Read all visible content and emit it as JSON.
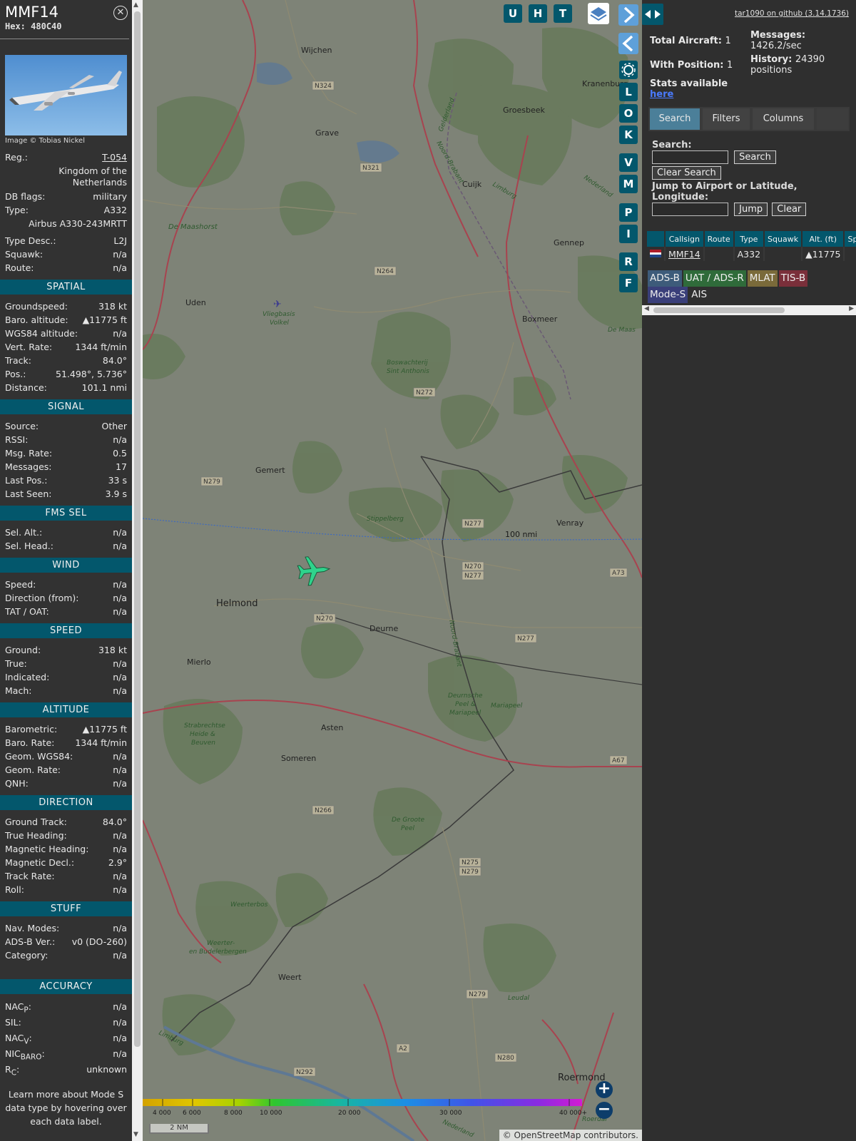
{
  "aircraft": {
    "callsign": "MMF14",
    "hex": "Hex: 480C40",
    "photo_credit": "Image © Tobias Nickel",
    "reg_label": "Reg.:",
    "reg": "T-054",
    "country": "Kingdom of the Netherlands",
    "dbflags_label": "DB flags:",
    "dbflags": "military",
    "type_label": "Type:",
    "type": "A332",
    "type_full": "Airbus A330-243MRTT",
    "typedesc_label": "Type Desc.:",
    "typedesc": "L2J",
    "squawk_label": "Squawk:",
    "squawk": "n/a",
    "route_label": "Route:",
    "route": "n/a"
  },
  "sections": {
    "spatial": "SPATIAL",
    "signal": "SIGNAL",
    "fms": "FMS SEL",
    "wind": "WIND",
    "speed": "SPEED",
    "altitude": "ALTITUDE",
    "direction": "DIRECTION",
    "stuff": "STUFF",
    "accuracy": "ACCURACY"
  },
  "spatial": [
    {
      "k": "Groundspeed:",
      "v": "318 kt"
    },
    {
      "k": "Baro. altitude:",
      "v": "▲11775 ft"
    },
    {
      "k": "WGS84 altitude:",
      "v": "n/a"
    },
    {
      "k": "Vert. Rate:",
      "v": "1344 ft/min"
    },
    {
      "k": "Track:",
      "v": "84.0°"
    },
    {
      "k": "Pos.:",
      "v": "51.498°, 5.736°"
    },
    {
      "k": "Distance:",
      "v": "101.1 nmi"
    }
  ],
  "signal": [
    {
      "k": "Source:",
      "v": "Other"
    },
    {
      "k": "RSSI:",
      "v": "n/a"
    },
    {
      "k": "Msg. Rate:",
      "v": "0.5"
    },
    {
      "k": "Messages:",
      "v": "17"
    },
    {
      "k": "Last Pos.:",
      "v": "33 s"
    },
    {
      "k": "Last Seen:",
      "v": "3.9 s"
    }
  ],
  "fms": [
    {
      "k": "Sel. Alt.:",
      "v": "n/a"
    },
    {
      "k": "Sel. Head.:",
      "v": "n/a"
    }
  ],
  "wind": [
    {
      "k": "Speed:",
      "v": "n/a"
    },
    {
      "k": "Direction (from):",
      "v": "n/a"
    },
    {
      "k": "TAT / OAT:",
      "v": "n/a"
    }
  ],
  "speed": [
    {
      "k": "Ground:",
      "v": "318 kt"
    },
    {
      "k": "True:",
      "v": "n/a"
    },
    {
      "k": "Indicated:",
      "v": "n/a"
    },
    {
      "k": "Mach:",
      "v": "n/a"
    }
  ],
  "altitude": [
    {
      "k": "Barometric:",
      "v": "▲11775 ft"
    },
    {
      "k": "Baro. Rate:",
      "v": "1344 ft/min"
    },
    {
      "k": "Geom. WGS84:",
      "v": "n/a"
    },
    {
      "k": "Geom. Rate:",
      "v": "n/a"
    },
    {
      "k": "QNH:",
      "v": "n/a"
    }
  ],
  "direction": [
    {
      "k": "Ground Track:",
      "v": "84.0°"
    },
    {
      "k": "True Heading:",
      "v": "n/a"
    },
    {
      "k": "Magnetic Heading:",
      "v": "n/a"
    },
    {
      "k": "Magnetic Decl.:",
      "v": "2.9°"
    },
    {
      "k": "Track Rate:",
      "v": "n/a"
    },
    {
      "k": "Roll:",
      "v": "n/a"
    }
  ],
  "stuff": [
    {
      "k": "Nav. Modes:",
      "v": "n/a"
    },
    {
      "k": "ADS-B Ver.:",
      "v": "v0 (DO-260)"
    },
    {
      "k": "Category:",
      "v": "n/a"
    }
  ],
  "accuracy": {
    "nacp": "NAC",
    "nacp_sub": "P",
    "nacp_v": "n/a",
    "sil": "SIL:",
    "sil_v": "n/a",
    "nacv": "NAC",
    "nacv_sub": "V",
    "nacv_v": "n/a",
    "nic": "NIC",
    "nic_sub": "BARO",
    "nic_v": "n/a",
    "rc": "R",
    "rc_sub": "C",
    "rc_v": "unknown"
  },
  "footer_text": "Learn more about Mode S data type by hovering over each data label.",
  "map": {
    "top_buttons": [
      "U",
      "H",
      "T"
    ],
    "side_buttons": [
      "L",
      "O",
      "K",
      "V",
      "M",
      "P",
      "I",
      "R",
      "F"
    ],
    "range_ring_label": "100 nmi",
    "scale_label": "2 NM",
    "attribution_prefix": "© ",
    "attribution_link": "OpenStreetMap",
    "attribution_suffix": " contributors.",
    "altitude_legend": [
      "4 000",
      "6 000",
      "8 000",
      "10 000",
      "20 000",
      "30 000",
      "40 000+"
    ],
    "towns": {
      "wijchen": "Wijchen",
      "grave": "Grave",
      "groesbeek": "Groesbeek",
      "cuijk": "Cuijk",
      "gennep": "Gennep",
      "kranenburg": "Kranenburg",
      "uden": "Uden",
      "boxmeer": "Boxmeer",
      "gemert": "Gemert",
      "venray": "Venray",
      "helmond": "Helmond",
      "deurne": "Deurne",
      "mierlo": "Mierlo",
      "asten": "Asten",
      "someren": "Someren",
      "weert": "Weert",
      "roermond": "Roermond"
    },
    "parks": {
      "maashorst": "De Maashorst",
      "volkel1": "Vliegbasis",
      "volkel2": "Volkel",
      "bos1": "Boswachterij",
      "bos2": "Sint Anthonis",
      "stippelberg": "Stippelberg",
      "peel1": "Deurnsche",
      "peel2": "Peel &",
      "peel3": "Mariapeel",
      "mariapeel": "Mariapeel",
      "strab1": "Strabrechtse",
      "strab2": "Heide &",
      "strab3": "Beuven",
      "groote1": "De Groote",
      "groote2": "Peel",
      "weerterbos": "Weerterbos",
      "weerter1": "Weerter-",
      "weerter2": "en Budelerbergen",
      "leudal": "Leudal",
      "demaas": "De Maas"
    },
    "roads": [
      "N324",
      "N321",
      "N264",
      "N272",
      "N279",
      "N277",
      "N270",
      "N277",
      "N270",
      "N277",
      "N266",
      "N275",
      "N279",
      "N279",
      "N280",
      "N292",
      "A2",
      "A73",
      "A67"
    ],
    "region_labels": {
      "gelderland": "Gelderland",
      "noordbrabant": "Noord-Brabant",
      "nederland": "Nederland",
      "noordbrabant2": "Noord-Brabant",
      "limburg": "Limburg",
      "limburg2": "Limburg",
      "nederland2": "Nederland",
      "roerdal": "Roerdal"
    }
  },
  "right": {
    "github": "tar1090 on github (3.14.1736)",
    "total_aircraft": "Total Aircraft: ",
    "total_aircraft_v": "1",
    "with_position": "With Position: ",
    "with_position_v": "1",
    "stats": "Stats available",
    "stats_link": "here",
    "messages_label": "Messages:",
    "messages_v": "1426.2/sec",
    "history_label": "History: ",
    "history_v": "24390 positions",
    "tabs": [
      "Search",
      "Filters",
      "Columns"
    ],
    "search_label": "Search:",
    "search_btn": "Search",
    "clear_search": "Clear Search",
    "jump_label": "Jump to Airport or Latitude, Longitude:",
    "jump_btn": "Jump",
    "clear_btn": "Clear",
    "columns": [
      "Callsign",
      "Route",
      "Type",
      "Squawk",
      "Alt. (ft)",
      "Spd"
    ],
    "row": {
      "callsign": "MMF14",
      "route": "",
      "type": "A332",
      "squawk": "",
      "alt": "▲11775",
      "spd": ""
    },
    "legend": [
      "ADS-B",
      "UAT / ADS-R",
      "MLAT",
      "TIS-B",
      "Mode-S",
      "AIS"
    ]
  }
}
